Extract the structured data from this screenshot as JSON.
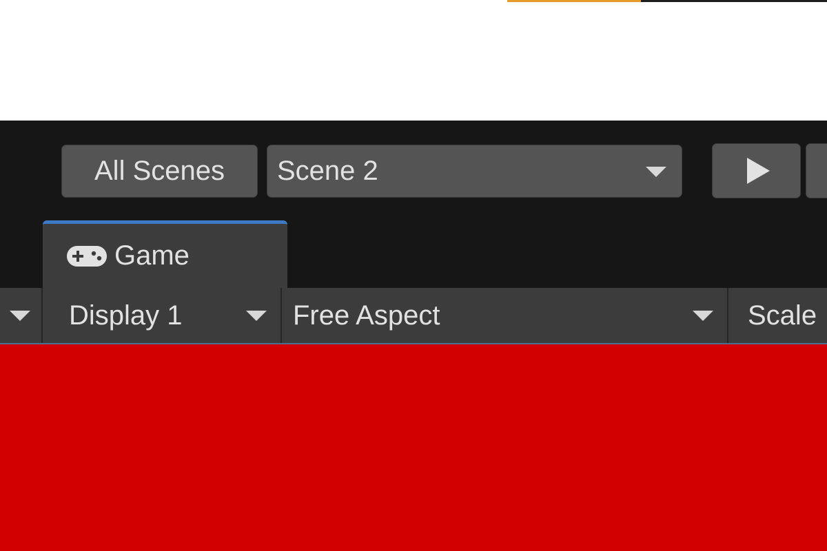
{
  "colors": {
    "toolbar_bg": "#161616",
    "button_bg": "#545454",
    "panel_bg": "#3c3c3c",
    "tab_accent": "#3d7bc6",
    "progress_orange": "#e59a2b",
    "viewport_bg": "#d20000"
  },
  "toolbar": {
    "all_scenes_label": "All Scenes",
    "scene_selected": "Scene 2",
    "play_icon": "play-icon",
    "dropdown_icon": "chevron-down-icon"
  },
  "tab": {
    "label": "Game",
    "icon": "gamepad-icon"
  },
  "game_view_toolbar": {
    "display_label": "Display 1",
    "aspect_label": "Free Aspect",
    "scale_label": "Scale"
  }
}
